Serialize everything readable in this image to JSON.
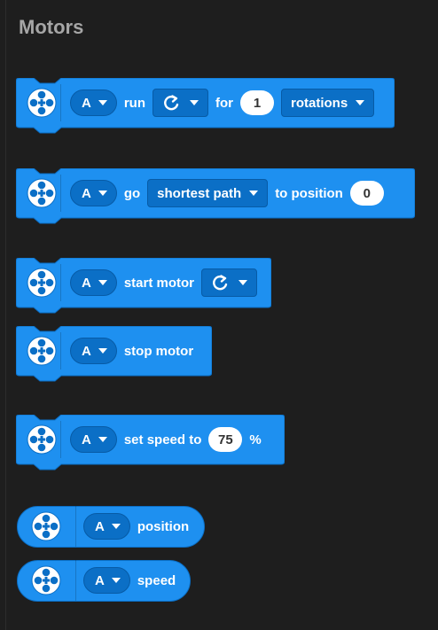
{
  "category": {
    "title": "Motors"
  },
  "colors": {
    "block": "#1e90f0",
    "block_dark": "#0b6fc6",
    "background": "#1e1e1e"
  },
  "blocks": [
    {
      "port": "A",
      "text1": "run",
      "direction_icon": "clockwise-arrow-icon",
      "text2": "for",
      "value": "1",
      "unit": "rotations"
    },
    {
      "port": "A",
      "text1": "go",
      "path": "shortest path",
      "text2": "to position",
      "value": "0"
    },
    {
      "port": "A",
      "text1": "start motor",
      "direction_icon": "clockwise-arrow-icon"
    },
    {
      "port": "A",
      "text1": "stop motor"
    },
    {
      "port": "A",
      "text1": "set speed to",
      "value": "75",
      "unit": "%"
    }
  ],
  "reporters": [
    {
      "port": "A",
      "label": "position"
    },
    {
      "port": "A",
      "label": "speed"
    }
  ]
}
